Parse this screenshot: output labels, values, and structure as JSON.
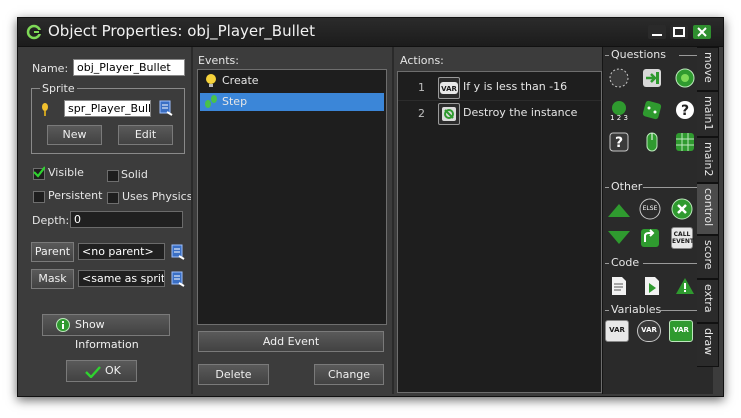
{
  "window": {
    "title": "Object Properties: obj_Player_Bullet"
  },
  "props": {
    "name_label": "Name:",
    "name_value": "obj_Player_Bullet",
    "sprite_group": "Sprite",
    "sprite_value": "spr_Player_Bullet",
    "new_label": "New",
    "edit_label": "Edit",
    "visible_label": "Visible",
    "visible_checked": true,
    "solid_label": "Solid",
    "persistent_label": "Persistent",
    "physics_label": "Uses Physics",
    "depth_label": "Depth:",
    "depth_value": "0",
    "parent_label": "Parent",
    "parent_value": "<no parent>",
    "mask_label": "Mask",
    "mask_value": "<same as sprite>",
    "show_info_label": "Show Information",
    "ok_label": "OK"
  },
  "events": {
    "header": "Events:",
    "items": [
      {
        "label": "Create",
        "icon": "lightbulb-icon",
        "selected": false
      },
      {
        "label": "Step",
        "icon": "footsteps-icon",
        "selected": true
      }
    ],
    "add_label": "Add Event",
    "delete_label": "Delete",
    "change_label": "Change"
  },
  "actions": {
    "header": "Actions:",
    "items": [
      {
        "num": "1",
        "icon": "var-icon",
        "text": "If y is less than -16"
      },
      {
        "num": "2",
        "icon": "destroy-instance-icon",
        "text": "Destroy the instance"
      }
    ]
  },
  "library": {
    "sections": {
      "questions": "Questions",
      "other": "Other",
      "code": "Code",
      "variables": "Variables"
    },
    "else_label": "ELSE",
    "call_event_label": "CALL EVENT",
    "var_label": "VAR"
  },
  "tabs": [
    "move",
    "main1",
    "main2",
    "control",
    "score",
    "extra",
    "draw"
  ],
  "active_tab": "control",
  "colors": {
    "selection": "#3b86d8",
    "accent_green": "#2f9a2f",
    "window_bg": "#3c3c3c"
  }
}
